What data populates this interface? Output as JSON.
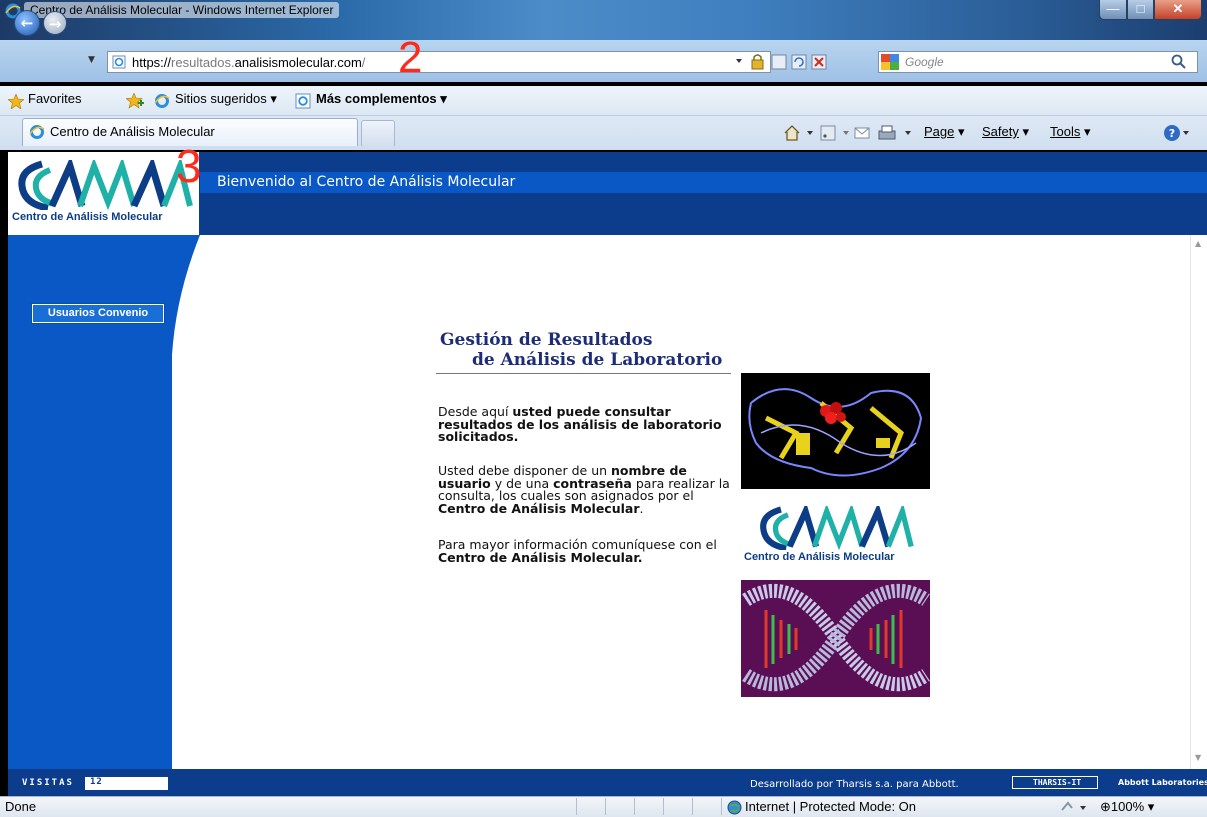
{
  "window": {
    "title": "Centro de Análisis Molecular - Windows Internet Explorer"
  },
  "address": {
    "url_prefix": "https://",
    "url_dim": "resultados.",
    "url_domain": "analisismolecular.com",
    "url_suffix": "/"
  },
  "search": {
    "placeholder": "Google"
  },
  "annotations": {
    "two": "2",
    "three": "3"
  },
  "favorites_bar": {
    "favorites_label": "Favorites",
    "sugeridos_label": "Sitios sugeridos",
    "complementos_label": "Más complementos"
  },
  "tabs": {
    "active_label": "Centro de Análisis Molecular"
  },
  "command_bar": {
    "page": "Page",
    "safety": "Safety",
    "tools": "Tools"
  },
  "site": {
    "header_title": "Bienvenido al Centro de Análisis Molecular",
    "logo_caption": "Centro de Análisis Molecular",
    "sidebar_button": "Usuarios Convenio",
    "heading_line1": "Gestión de Resultados",
    "heading_line2": "de Análisis de Laboratorio",
    "para1_prefix": "Desde aquí ",
    "para1_bold": "usted puede consultar resultados de los análisis de laboratorio solicitados.",
    "para2_a": "Usted debe disponer de un ",
    "para2_b": "nombre de usuario",
    "para2_c": " y de una ",
    "para2_d": "contraseña",
    "para2_e": " para realizar la consulta, los cuales son asignados por el ",
    "para2_f": "Centro de Análisis Molecular",
    "para2_g": ".",
    "para3_a": "Para mayor información comuníquese con el ",
    "para3_b": "Centro de Análisis Molecular.",
    "image_logo_caption": "Centro de Análisis Molecular",
    "visitas_label": "VISITAS",
    "visitas_value": "12",
    "footer_credit": "Desarrollado por Tharsis s.a. para Abbott.",
    "tharsis_badge": "THARSIS-IT",
    "abbott_badge": "Abbott Laboratories"
  },
  "status": {
    "left": "Done",
    "zone": "Internet | Protected Mode: On",
    "zoom": "100%"
  },
  "colors": {
    "header_blue": "#0c3c8c",
    "accent_blue": "#0a58c6",
    "heading_navy": "#1d2c78",
    "annotation_red": "#ff2a1a"
  },
  "icons": [
    "ie-icon",
    "back-arrow-icon",
    "forward-arrow-icon",
    "lock-icon",
    "refresh-icon",
    "stop-icon",
    "search-icon",
    "star-icon",
    "home-icon",
    "rss-icon",
    "mail-icon",
    "print-icon",
    "help-icon",
    "globe-icon"
  ]
}
